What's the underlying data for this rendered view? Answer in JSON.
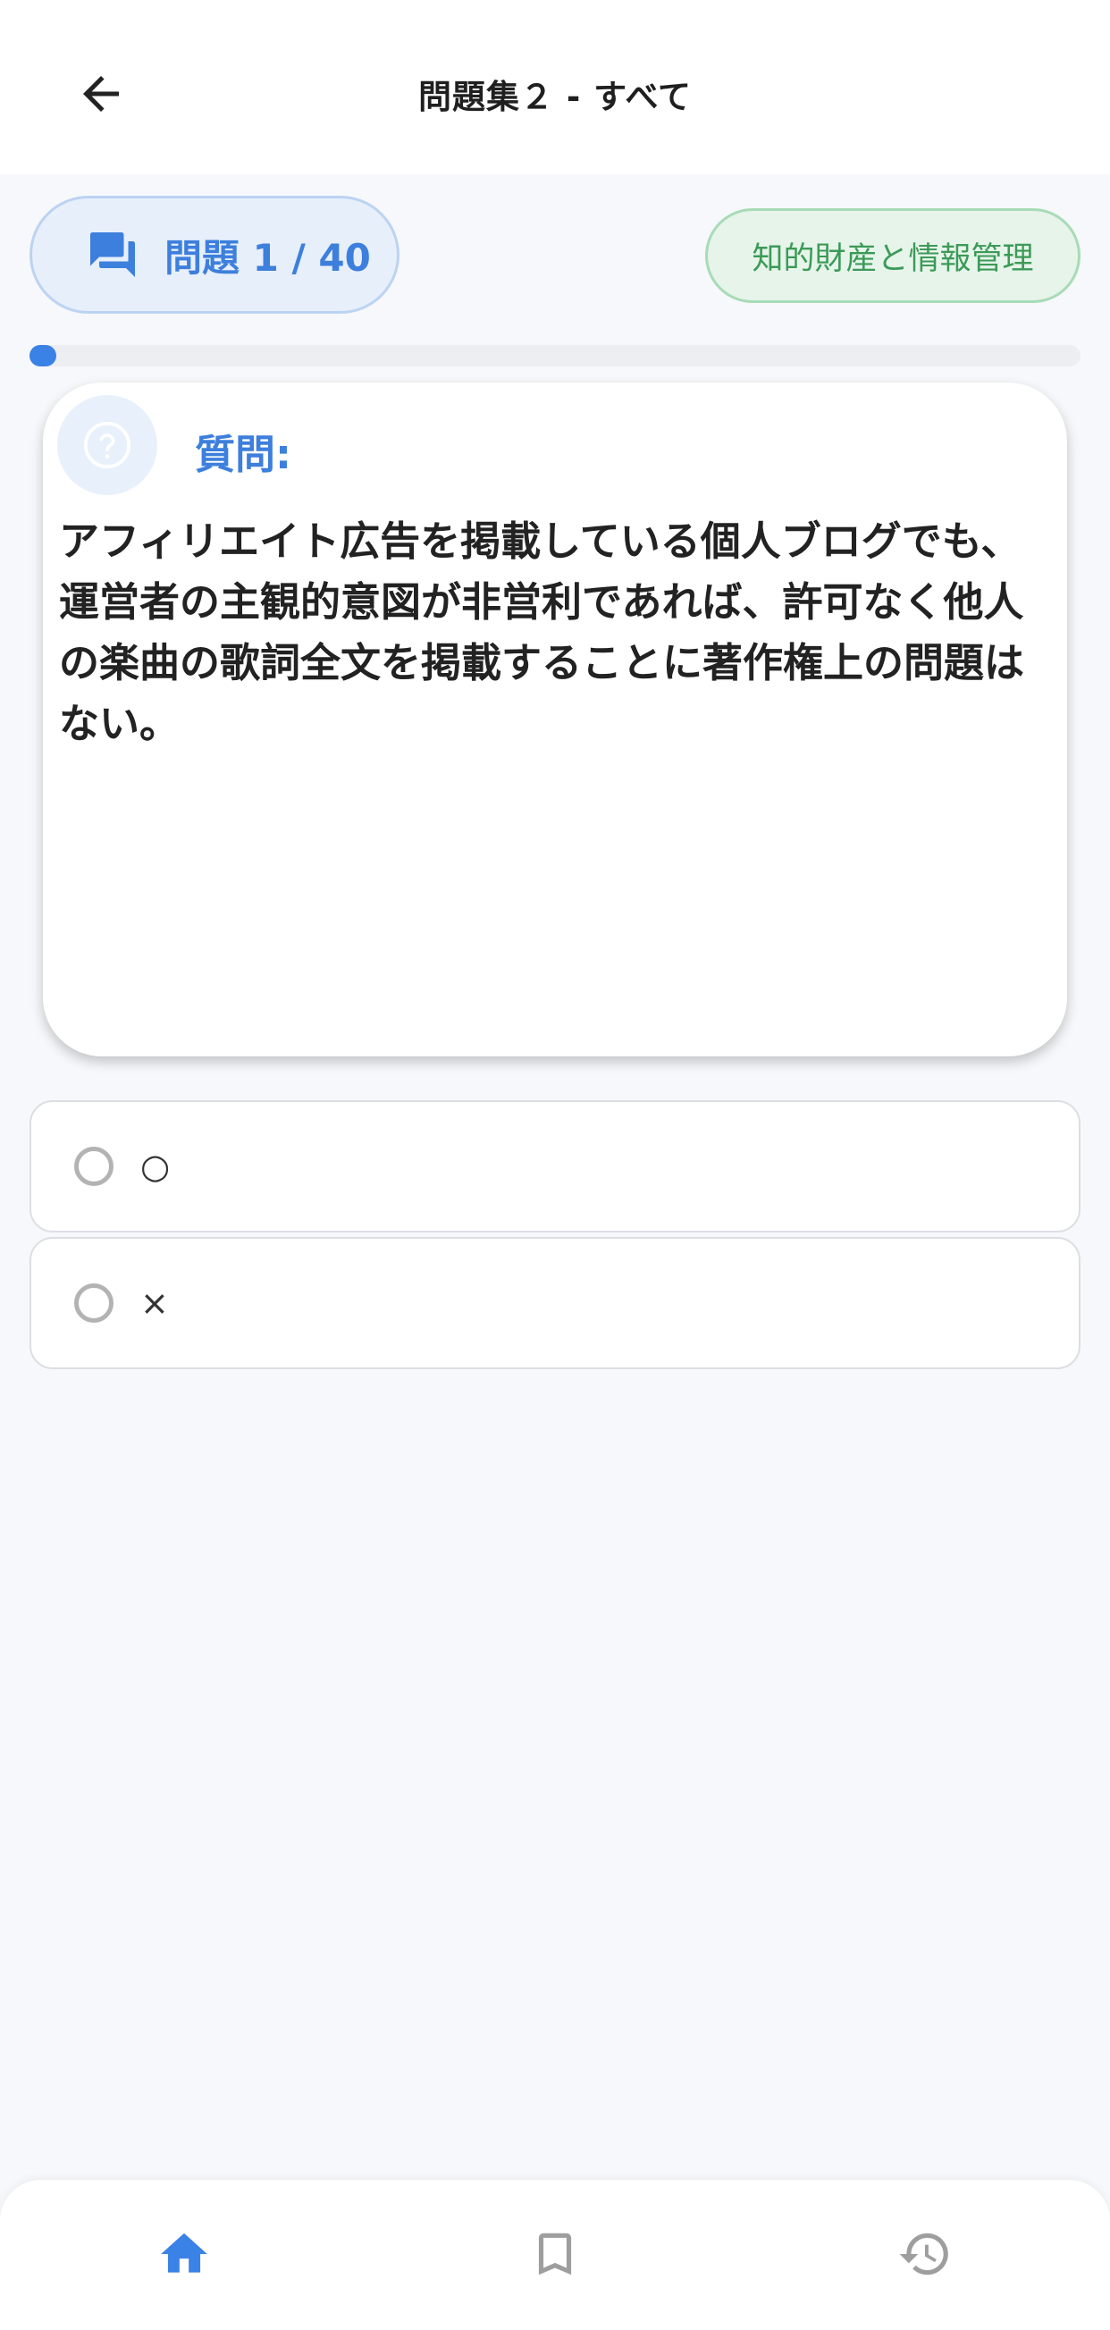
{
  "appbar": {
    "title": "問題集２ - すべて",
    "back_icon": "arrow-back-icon"
  },
  "counter": {
    "text": "問題 1 / 40",
    "current": 1,
    "total": 40,
    "icon": "chat-bubbles-icon"
  },
  "category": {
    "label": "知的財産と情報管理"
  },
  "progress": {
    "fraction": 0.025,
    "color": "#3b82e6"
  },
  "question": {
    "icon": "help-circle-icon",
    "label": "質問:",
    "text": "アフィリエイト広告を掲載している個人ブログでも、運営者の主観的意図が非営利であれば、許可なく他人の楽曲の歌詞全文を掲載することに著作権上の問題はない。"
  },
  "options": [
    {
      "label": "○",
      "selected": false
    },
    {
      "label": "×",
      "selected": false
    }
  ],
  "bottom_nav": {
    "items": [
      {
        "icon": "home-icon",
        "active": true
      },
      {
        "icon": "bookmark-icon",
        "active": false
      },
      {
        "icon": "history-icon",
        "active": false
      }
    ]
  },
  "colors": {
    "accent": "#3b82e6",
    "chip_green": "#3c9a57",
    "inactive_icon": "#9e9e9e"
  }
}
